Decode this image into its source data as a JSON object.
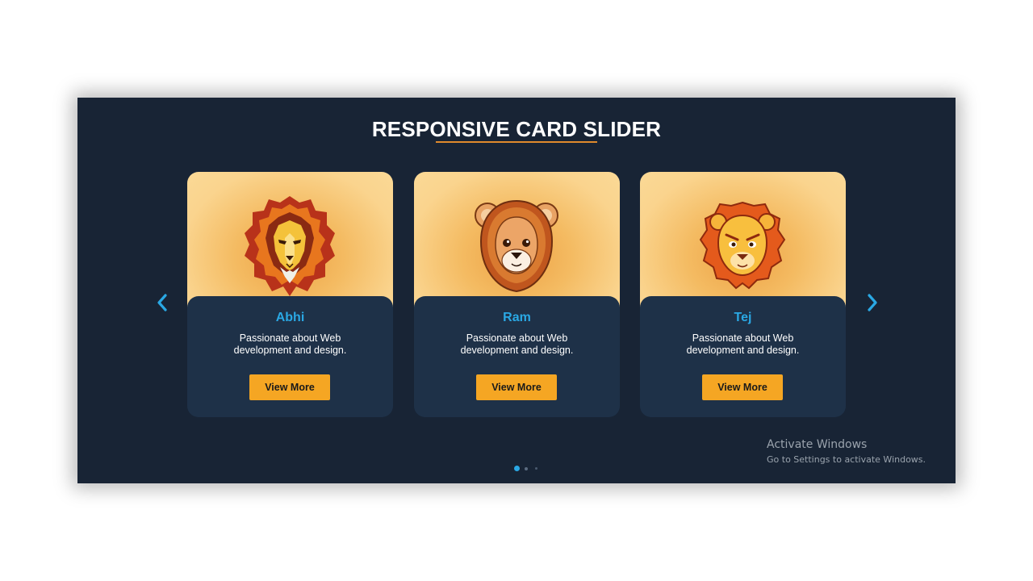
{
  "slider": {
    "title": "RESPONSIVE CARD SLIDER",
    "colors": {
      "background": "#182435",
      "card_bottom": "#1e3148",
      "accent_orange": "#f5a623",
      "name_blue": "#2aa8e4",
      "underline": "#e08a2c"
    },
    "prev_icon": "chevron-left-icon",
    "next_icon": "chevron-right-icon",
    "cards": [
      {
        "name": "Abhi",
        "description": "Passionate about Web development and design.",
        "button_label": "View More",
        "image": "fierce-lion-mane-icon"
      },
      {
        "name": "Ram",
        "description": "Passionate about Web development and design.",
        "button_label": "View More",
        "image": "cute-lion-cub-icon"
      },
      {
        "name": "Tej",
        "description": "Passionate about Web development and design.",
        "button_label": "View More",
        "image": "cartoon-lion-icon"
      }
    ],
    "pagination": {
      "total": 3,
      "active": 1
    }
  },
  "watermark": {
    "title": "Activate Windows",
    "subtitle": "Go to Settings to activate Windows."
  }
}
